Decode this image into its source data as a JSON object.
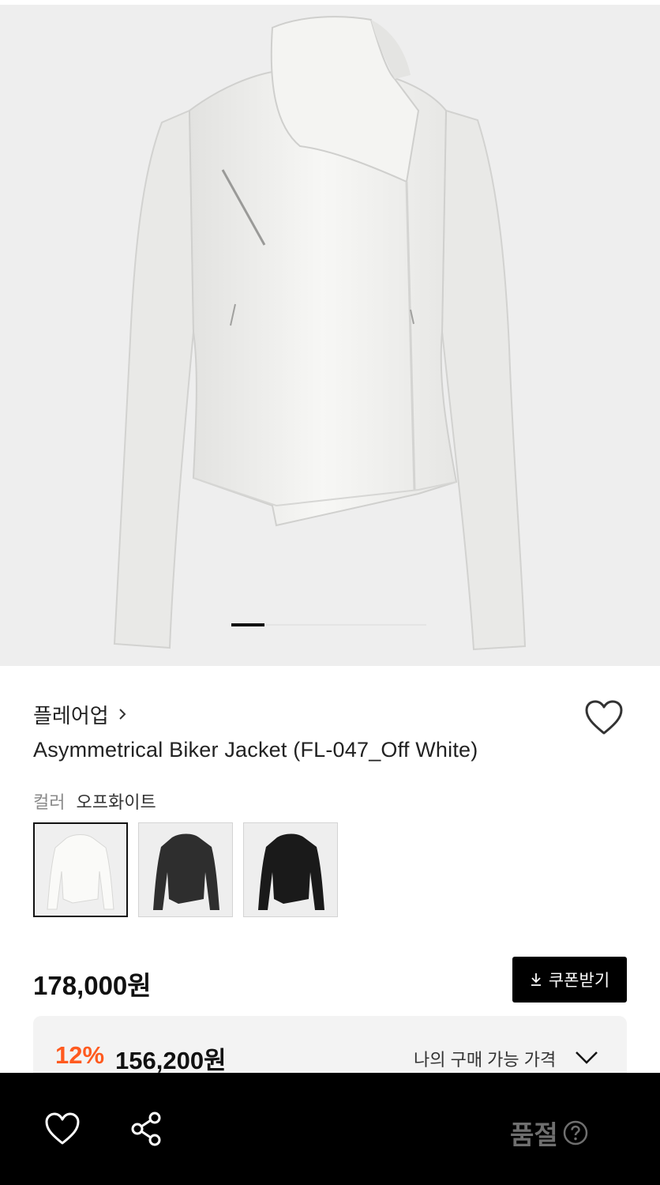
{
  "gallery": {
    "image_alt": "Asymmetrical Biker Jacket off white",
    "slide_index": 1
  },
  "product": {
    "brand": "플레어업",
    "title": "Asymmetrical Biker Jacket (FL-047_Off White)",
    "color_label": "컬러",
    "color_value": "오프화이트",
    "swatches": [
      {
        "name": "오프화이트",
        "color": "#ececec",
        "selected": true
      },
      {
        "name": "charcoal",
        "color": "#2a2a2a",
        "selected": false
      },
      {
        "name": "black",
        "color": "#1a1a1a",
        "selected": false
      }
    ]
  },
  "pricing": {
    "price": "178,000원",
    "coupon_button": "쿠폰받기",
    "discount_rate": "12%",
    "best_price": "156,200원",
    "best_price_label": "나의 구매 가능 가격"
  },
  "bottom_bar": {
    "status_label": "품절"
  },
  "colors": {
    "accent": "#ff5a1f",
    "bar_bg": "#000000",
    "soldout_text": "#6f6f6f"
  }
}
